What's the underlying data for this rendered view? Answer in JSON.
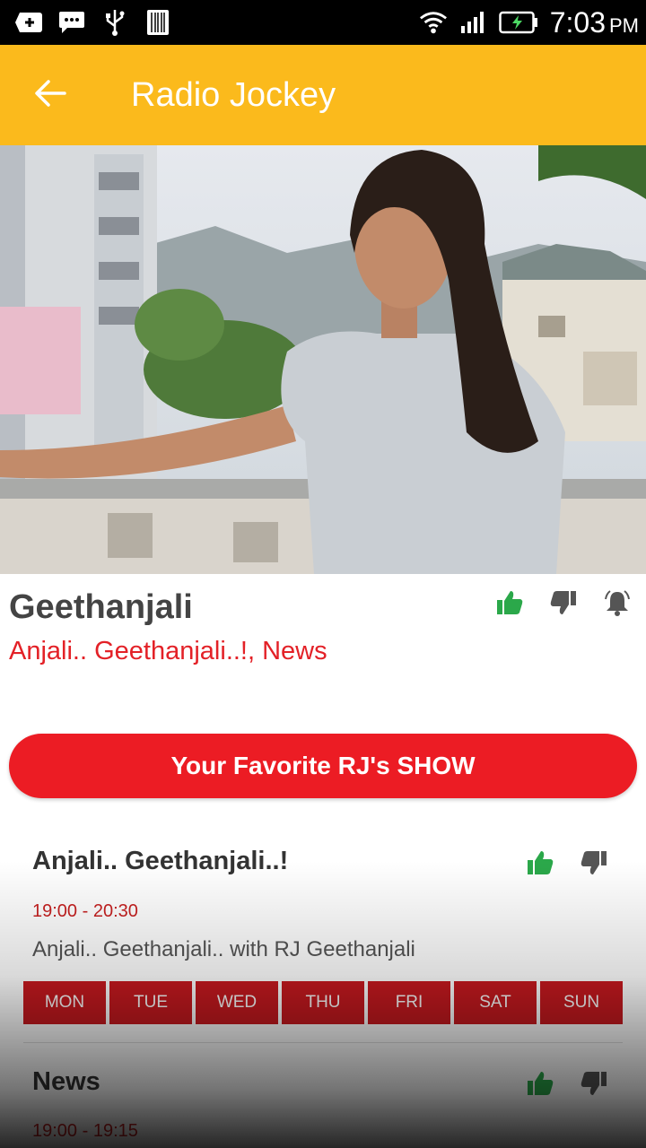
{
  "status_bar": {
    "time": "7:03",
    "ampm": "PM",
    "icons": [
      "add-icon",
      "message-icon",
      "usb-icon",
      "barcode-icon",
      "wifi-icon",
      "signal-icon",
      "battery-charging-icon"
    ]
  },
  "app_bar": {
    "title": "Radio Jockey",
    "back_icon": "arrow-left-icon",
    "color": "#FBBA1C"
  },
  "rj": {
    "name": "Geethanjali",
    "tags": "Anjali.. Geethanjali..!, News",
    "actions": [
      "thumbs-up-icon",
      "thumbs-down-icon",
      "bell-icon"
    ]
  },
  "favorite_button": {
    "label": "Your Favorite RJ's SHOW",
    "color": "#EC1C24"
  },
  "shows": [
    {
      "title": "Anjali.. Geethanjali..!",
      "time": "19:00 - 20:30",
      "description": "Anjali.. Geethanjali.. with RJ Geethanjali",
      "days": [
        "MON",
        "TUE",
        "WED",
        "THU",
        "FRI",
        "SAT",
        "SUN"
      ]
    },
    {
      "title": "News",
      "time": "19:00 - 19:15"
    }
  ],
  "colors": {
    "like": "#2BA84A",
    "dislike": "#555555",
    "accent_red": "#E32127",
    "day_bg": "#C8191F"
  }
}
